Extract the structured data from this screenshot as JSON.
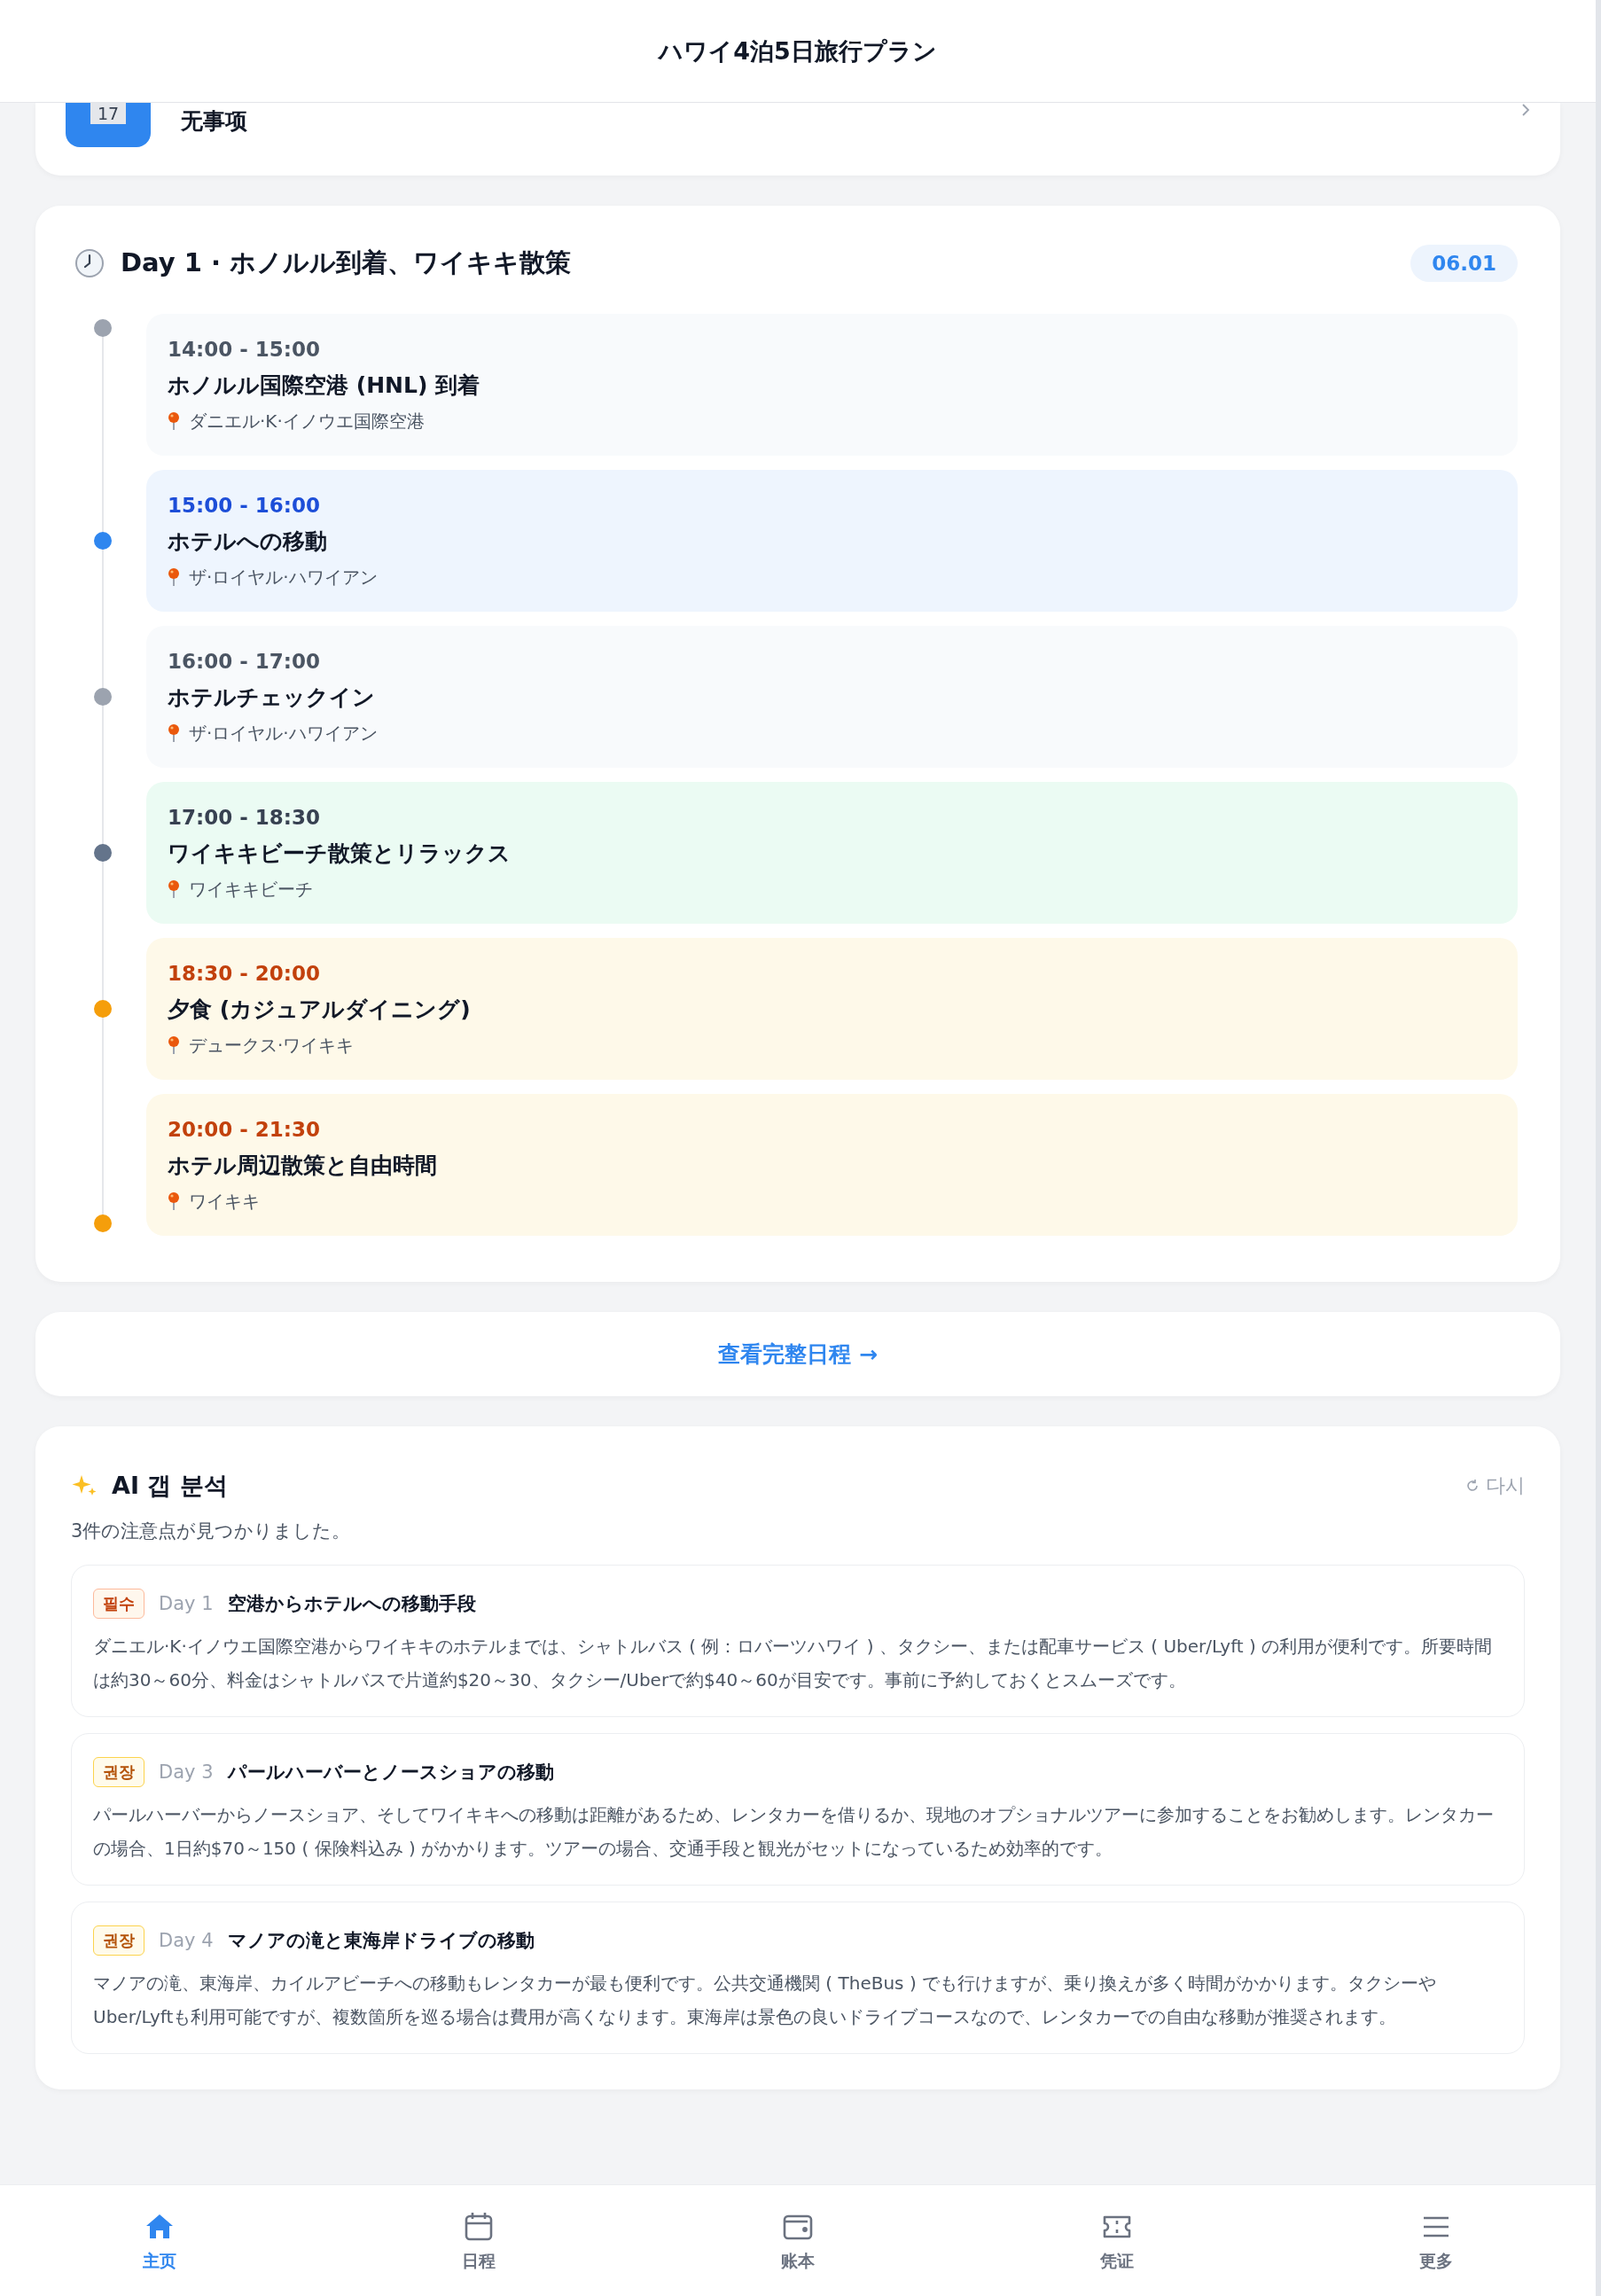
{
  "header": {
    "title": "ハワイ4泊5日旅行プラン"
  },
  "today_card": {
    "date": "17",
    "text": "无事项"
  },
  "day": {
    "title": "Day 1 · ホノルル到着、ワイキキ散策",
    "date": "06.01",
    "items": [
      {
        "kind": "plain",
        "time": "14:00 - 15:00",
        "title": "ホノルル国際空港 (HNL) 到着",
        "place": "ダニエル·K·イノウエ国際空港"
      },
      {
        "kind": "move",
        "time": "15:00 - 16:00",
        "title": "ホテルへの移動",
        "place": "ザ·ロイヤル·ハワイアン"
      },
      {
        "kind": "plain",
        "time": "16:00 - 17:00",
        "title": "ホテルチェックイン",
        "place": "ザ·ロイヤル·ハワイアン"
      },
      {
        "kind": "leisure",
        "time": "17:00 - 18:30",
        "title": "ワイキキビーチ散策とリラックス",
        "place": "ワイキキビーチ"
      },
      {
        "kind": "dining",
        "time": "18:30 - 20:00",
        "title": "夕食 (カジュアルダイニング)",
        "place": "デュークス·ワイキキ"
      },
      {
        "kind": "dining",
        "time": "20:00 - 21:30",
        "title": "ホテル周辺散策と自由時間",
        "place": "ワイキキ"
      }
    ]
  },
  "full_schedule_link": "查看完整日程 →",
  "ai": {
    "title": "AI 갭 분석",
    "retry": "다시",
    "summary": "3件の注意点が見つかりました。",
    "items": [
      {
        "kind": "required",
        "badge": "필수",
        "day": "Day 1",
        "title": "空港からホテルへの移動手段",
        "body": "ダニエル·K·イノウエ国際空港からワイキキのホテルまでは、シャトルバス ( 例：ロバーツハワイ ) 、タクシー、または配車サービス ( Uber/Lyft ) の利用が便利です。所要時間は約30～60分、料金はシャトルバスで片道約$20～30、タクシー/Uberで約$40～60が目安です。事前に予約しておくとスムーズです。"
      },
      {
        "kind": "recommended",
        "badge": "권장",
        "day": "Day 3",
        "title": "パールハーバーとノースショアの移動",
        "body": "パールハーバーからノースショア、そしてワイキキへの移動は距離があるため、レンタカーを借りるか、現地のオプショナルツアーに参加することをお勧めします。レンタカーの場合、1日約$70～150 ( 保険料込み ) がかかります。ツアーの場合、交通手段と観光がセットになっているため効率的です。"
      },
      {
        "kind": "recommended",
        "badge": "권장",
        "day": "Day 4",
        "title": "マノアの滝と東海岸ドライブの移動",
        "body": "マノアの滝、東海岸、カイルアビーチへの移動もレンタカーが最も便利です。公共交通機関 ( TheBus ) でも行けますが、乗り換えが多く時間がかかります。タクシーやUber/Lyftも利用可能ですが、複数箇所を巡る場合は費用が高くなります。東海岸は景色の良いドライブコースなので、レンタカーでの自由な移動が推奨されます。"
      }
    ]
  },
  "nav": [
    {
      "kind": "home",
      "label": "主页",
      "selected": true
    },
    {
      "kind": "calendar",
      "label": "日程",
      "selected": false
    },
    {
      "kind": "wallet",
      "label": "账本",
      "selected": false
    },
    {
      "kind": "ticket",
      "label": "凭证",
      "selected": false
    },
    {
      "kind": "menu",
      "label": "更多",
      "selected": false
    }
  ]
}
